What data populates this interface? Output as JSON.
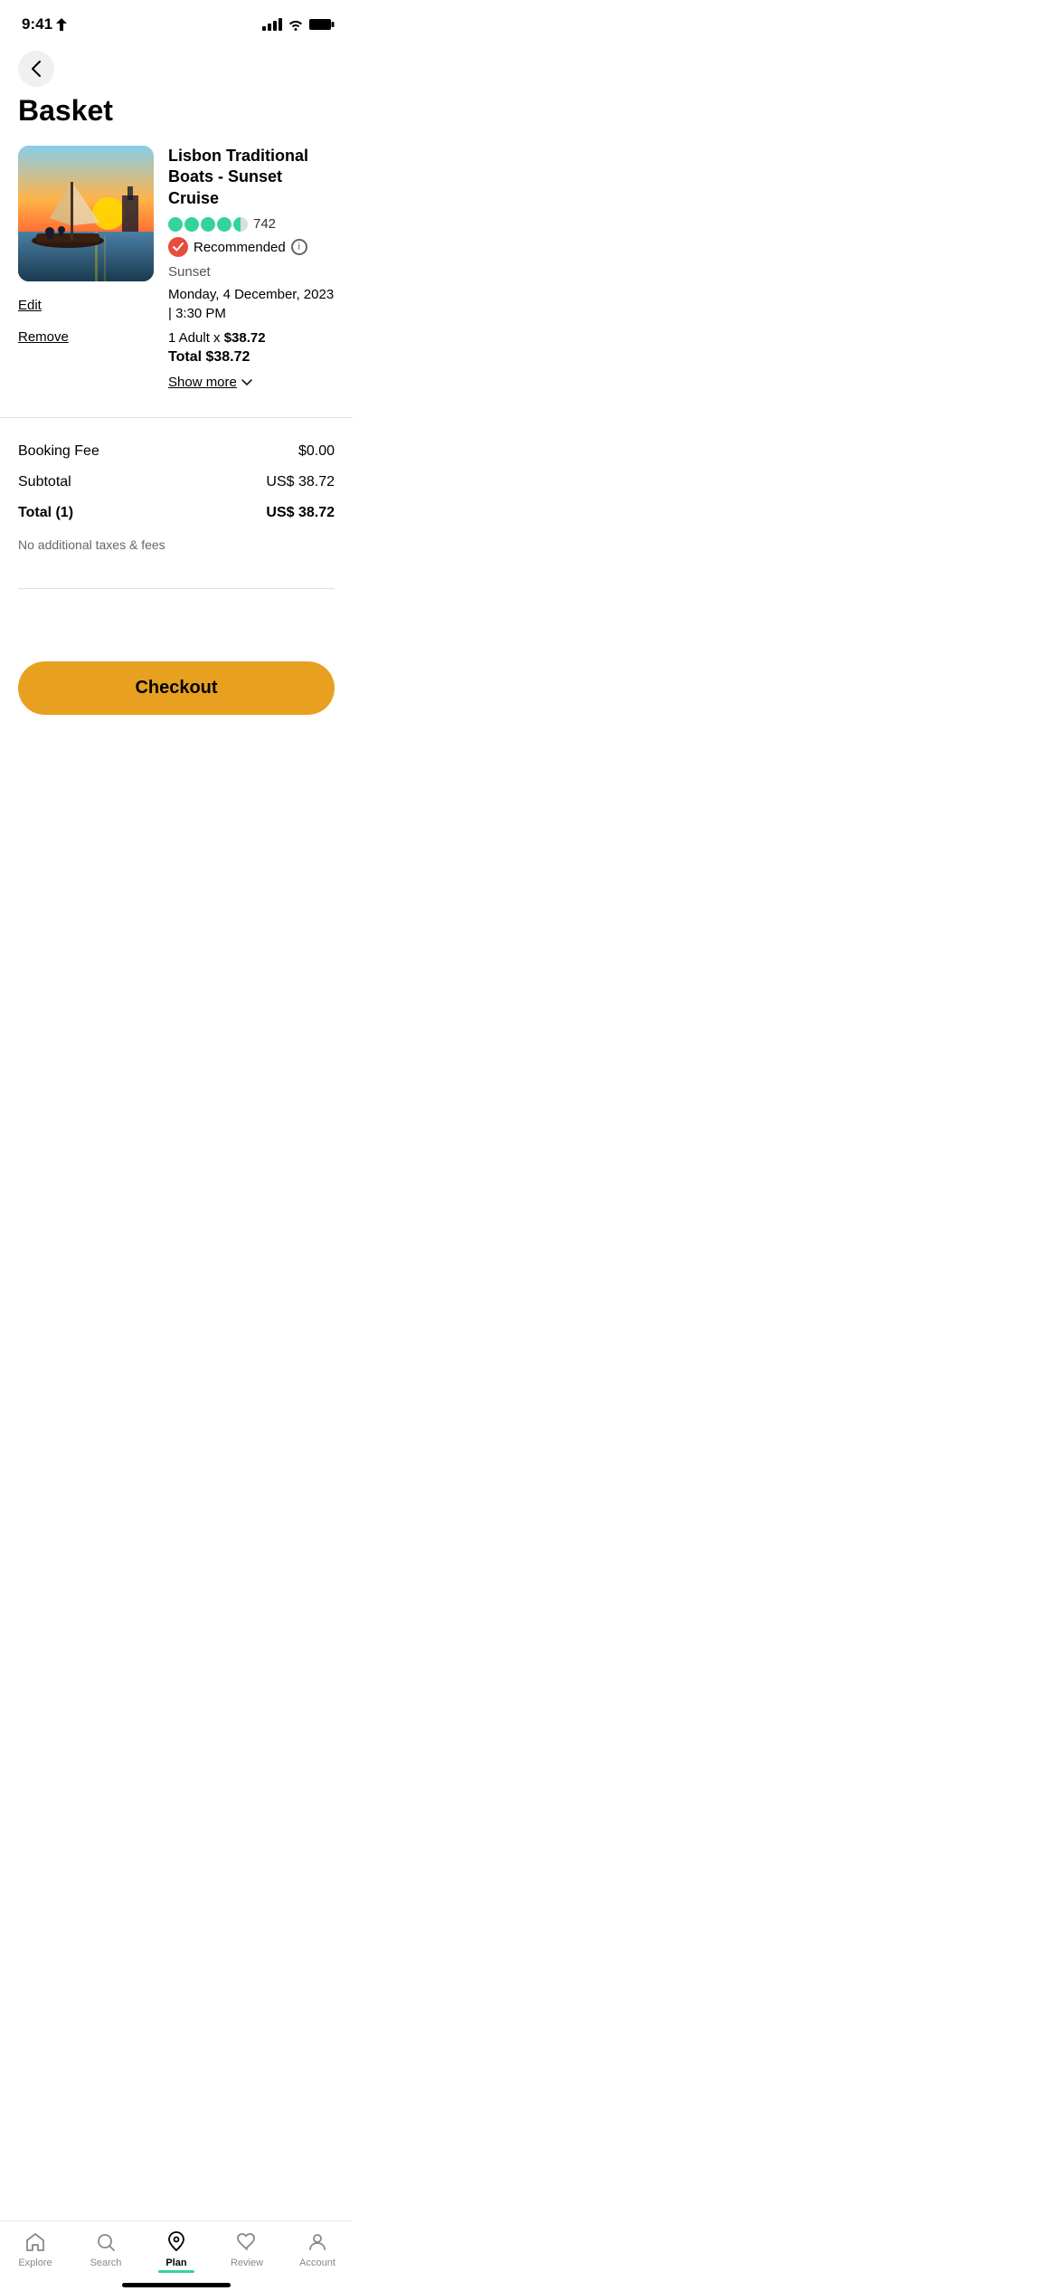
{
  "statusBar": {
    "time": "9:41",
    "locationIcon": "▶"
  },
  "header": {
    "backLabel": "‹",
    "title": "Basket"
  },
  "booking": {
    "title": "Lisbon Traditional Boats - Sunset Cruise",
    "reviewCount": "742",
    "recommendedLabel": "Recommended",
    "tourType": "Sunset",
    "date": "Monday, 4 December, 2023 | 3:30 PM",
    "priceRow": "1 Adult x ",
    "unitPrice": "$38.72",
    "totalLabel": "Total ",
    "totalPrice": "$38.72",
    "showMoreLabel": "Show more",
    "editLabel": "Edit",
    "removeLabel": "Remove"
  },
  "summary": {
    "bookingFeeLabel": "Booking Fee",
    "bookingFeeValue": "$0.00",
    "subtotalLabel": "Subtotal",
    "subtotalValue": "US$ 38.72",
    "totalLabel": "Total (1)",
    "totalValue": "US$ 38.72",
    "taxesNote": "No additional taxes & fees"
  },
  "checkout": {
    "buttonLabel": "Checkout"
  },
  "bottomNav": {
    "items": [
      {
        "id": "explore",
        "label": "Explore",
        "active": false
      },
      {
        "id": "search",
        "label": "Search",
        "active": false
      },
      {
        "id": "plan",
        "label": "Plan",
        "active": true
      },
      {
        "id": "review",
        "label": "Review",
        "active": false
      },
      {
        "id": "account",
        "label": "Account",
        "active": false
      }
    ]
  }
}
